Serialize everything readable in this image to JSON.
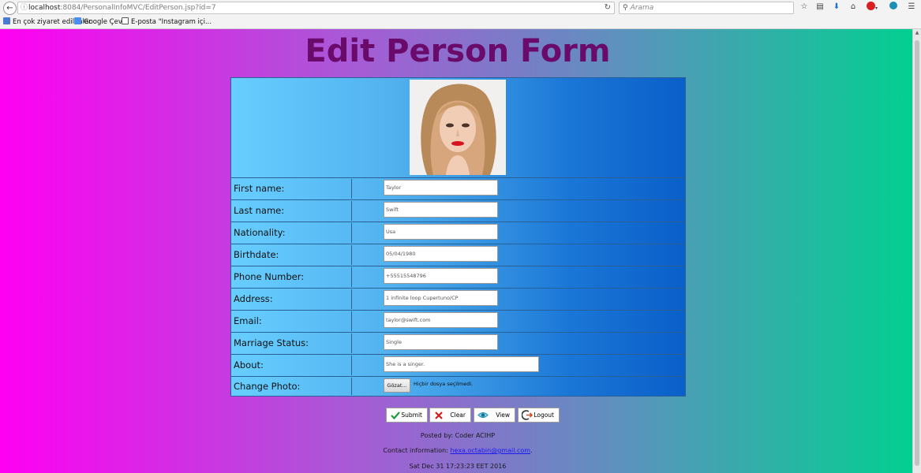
{
  "browser": {
    "url_host": "localhost",
    "url_path": ":8084/PersonalInfoMVC/EditPerson.jsp?id=7",
    "search_placeholder": "Arama",
    "bookmarks": [
      "En çok ziyaret edilenler",
      "Google Çeviri",
      "E-posta \"Instagram içi..."
    ]
  },
  "page": {
    "title": "Edit Person Form"
  },
  "form": {
    "fields": [
      {
        "label": "First name:",
        "value": "Taylor"
      },
      {
        "label": "Last name:",
        "value": "Swift"
      },
      {
        "label": "Nationality:",
        "value": "Usa"
      },
      {
        "label": "Birthdate:",
        "value": "05/04/1980"
      },
      {
        "label": "Phone Number:",
        "value": "+55515548796"
      },
      {
        "label": "Address:",
        "value": "1 infinite loop Cupertuno/CP"
      },
      {
        "label": "Email:",
        "value": "taylor@swift.com"
      },
      {
        "label": "Marriage Status:",
        "value": "Single"
      },
      {
        "label": "About:",
        "value": "She is a singer."
      }
    ],
    "photo_label": "Change Photo:",
    "file_button": "Gözat...",
    "file_status": "Hiçbir dosya seçilmedi."
  },
  "actions": {
    "submit": "Submit",
    "clear": "Clear",
    "view": "View",
    "logout": "Logout"
  },
  "footer": {
    "posted_by": "Posted by: Coder ACIHP",
    "contact_label": "Contact information: ",
    "contact_email": "hexa.octabin@gmail.com",
    "contact_suffix": ".",
    "datetime": "Sat Dec 31 17:23:23 EET 2016"
  },
  "colors": {
    "title": "#6a0a6b",
    "gradient_left": "#ff00f2",
    "gradient_right": "#00d18f"
  }
}
